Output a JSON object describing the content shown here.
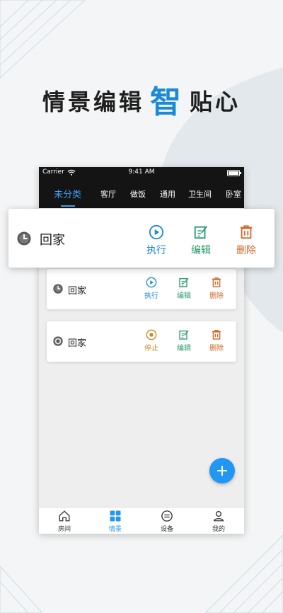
{
  "headline": {
    "before": "情景编辑",
    "accent": "智",
    "after": "贴心"
  },
  "statusbar": {
    "carrier": "Carrier",
    "time": "9:41 AM"
  },
  "tabs": [
    {
      "label": "未分类",
      "active": true
    },
    {
      "label": "客厅",
      "active": false
    },
    {
      "label": "做饭",
      "active": false
    },
    {
      "label": "通用",
      "active": false
    },
    {
      "label": "卫生间",
      "active": false
    },
    {
      "label": "卧室",
      "active": false
    }
  ],
  "scenes": [
    {
      "name": "回家",
      "state_icon": "clock-icon",
      "primary_action": "执行",
      "primary_icon": "play-circle-icon",
      "edit": "编辑",
      "delete": "删除"
    },
    {
      "name": "回家",
      "state_icon": "clock-icon",
      "primary_action": "执行",
      "primary_icon": "play-circle-icon",
      "edit": "编辑",
      "delete": "删除"
    },
    {
      "name": "回家",
      "state_icon": "running-icon",
      "primary_action": "停止",
      "primary_icon": "stop-circle-icon",
      "edit": "编辑",
      "delete": "删除"
    }
  ],
  "bottom_nav": [
    {
      "label": "房间",
      "icon": "home-icon",
      "active": false
    },
    {
      "label": "情景",
      "icon": "grid-icon",
      "active": true
    },
    {
      "label": "设备",
      "icon": "device-icon",
      "active": false
    },
    {
      "label": "我的",
      "icon": "user-icon",
      "active": false
    }
  ],
  "colors": {
    "accent": "#1a8bd4",
    "execute": "#1e88d3",
    "edit": "#2c9a6c",
    "delete": "#d0682a",
    "stop": "#c38a1e",
    "tab_active": "#3ea2f5"
  }
}
